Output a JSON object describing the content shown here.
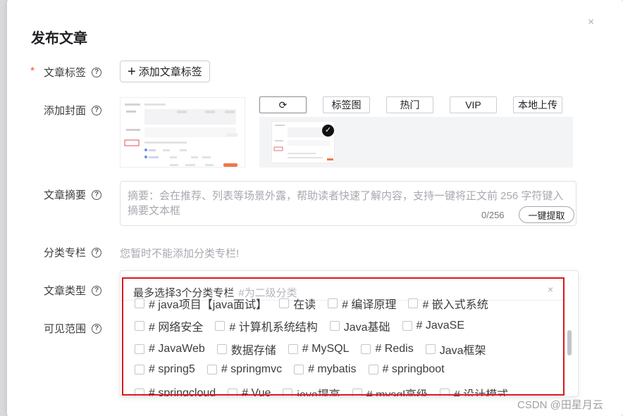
{
  "dialog": {
    "title": "发布文章",
    "close_icon": "×",
    "required_mark": "*"
  },
  "rows": {
    "tags_label": "文章标签",
    "cover_label": "添加封面",
    "summary_label": "文章摘要",
    "column_label": "分类专栏",
    "type_label": "文章类型",
    "visibility_label": "可见范围",
    "help_glyph": "?"
  },
  "tags": {
    "add_button": "添加文章标签"
  },
  "cover": {
    "refresh_glyph": "⟳",
    "buttons": [
      "标签图",
      "热门",
      "VIP",
      "本地上传"
    ],
    "selected_glyph": "✓"
  },
  "summary": {
    "placeholder": "摘要：会在推荐、列表等场景外露，帮助读者快速了解内容，支持一键将正文前 256 字符键入摘要文本框",
    "count": "0/256",
    "extract_button": "一键提取"
  },
  "column": {
    "note": "您暂时不能添加分类专栏!"
  },
  "dropdown": {
    "header": "最多选择3个分类专栏",
    "header_hint": "#为二级分类",
    "close_glyph": "×",
    "rows": [
      [
        "# java项目【java面试】",
        "在读",
        "# 编译原理",
        "# 嵌入式系统"
      ],
      [
        "# 网络安全",
        "# 计算机系统结构",
        "Java基础",
        "# JavaSE"
      ],
      [
        "# JavaWeb",
        "数据存储",
        "# MySQL",
        "# Redis",
        "Java框架"
      ],
      [
        "# spring5",
        "# springmvc",
        "# mybatis",
        "# springboot"
      ],
      [
        "# springcloud",
        "# Vue",
        "java提高",
        "# mysql高级",
        "# 设计模式"
      ]
    ]
  },
  "watermark": "CSDN @田星月云",
  "colors": {
    "required": "#fc5531",
    "annotation_outline": "#d9171c",
    "placeholder_text": "#a8a8b0"
  }
}
